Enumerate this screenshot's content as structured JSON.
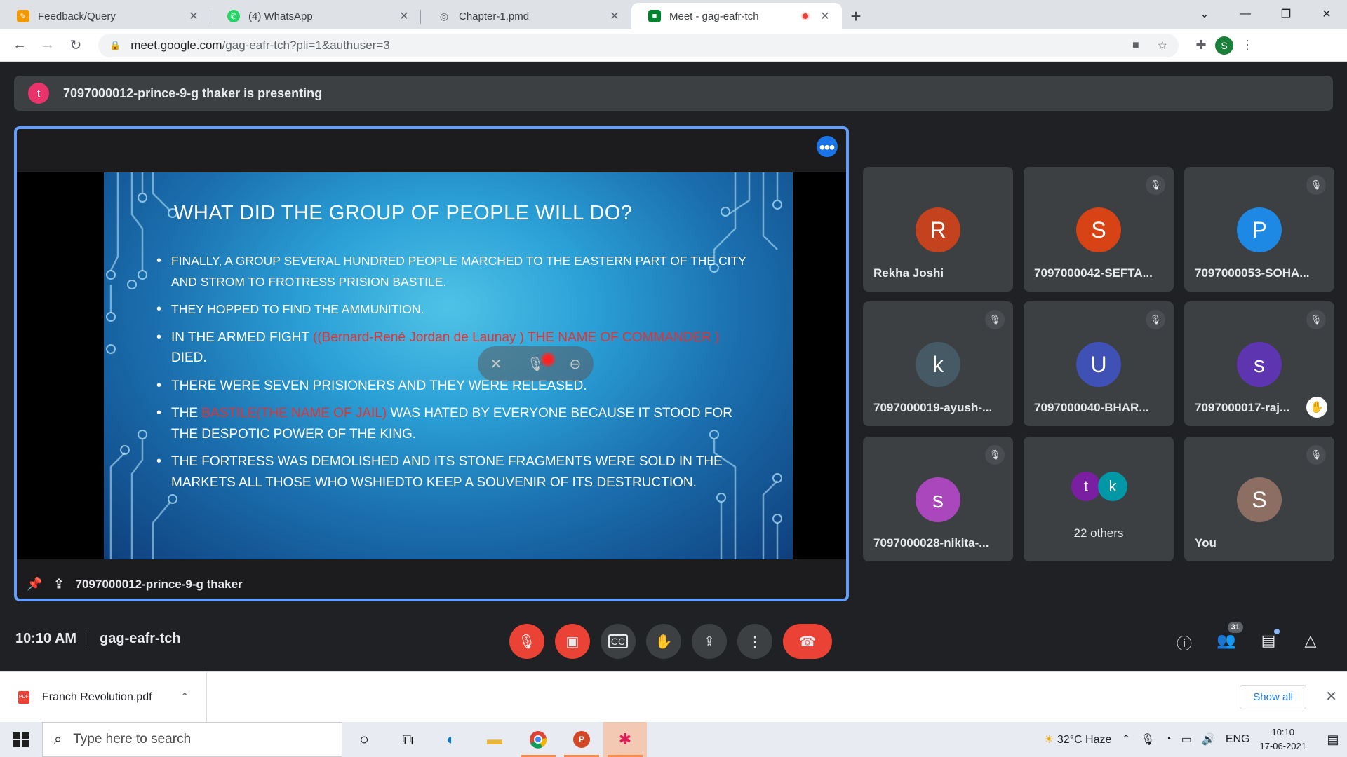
{
  "browser": {
    "tabs": [
      {
        "title": "Feedback/Query",
        "icon": "feedback-icon",
        "color": "#f29900"
      },
      {
        "title": "(4) WhatsApp",
        "icon": "whatsapp-icon",
        "color": "#25d366"
      },
      {
        "title": "Chapter-1.pmd",
        "icon": "globe-icon",
        "color": "#9aa0a6"
      },
      {
        "title": "Meet - gag-eafr-tch",
        "icon": "meet-icon",
        "color": "#00832d"
      }
    ],
    "address": {
      "domain": "meet.google.com",
      "path": "/gag-eafr-tch?pli=1&authuser=3"
    },
    "profile_initial": "S"
  },
  "meet": {
    "banner": {
      "avatar": "t",
      "text": "7097000012-prince-9-g thaker is presenting"
    },
    "presenter_name": "7097000012-prince-9-g thaker",
    "slide": {
      "title": "WHAT DID THE GROUP OF PEOPLE WILL DO?",
      "bullets": [
        {
          "parts": [
            {
              "t": "FINALLY, A GROUP SEVERAL HUNDRED PEOPLE MARCHED TO THE EASTERN PART  OF THE CITY  AND STROM TO FROTRESS PRISION  BASTILE.",
              "red": false
            }
          ],
          "small": true
        },
        {
          "parts": [
            {
              "t": "THEY HOPPED  TO  FIND THE AMMUNITION.",
              "red": false
            }
          ],
          "small": true
        },
        {
          "parts": [
            {
              "t": "IN THE ARMED FIGHT ",
              "red": false
            },
            {
              "t": "((Bernard-René Jordan de Launay ) THE NAME OF COMMANDER )",
              "red": true
            },
            {
              "t": " DIED.",
              "red": false
            }
          ],
          "small": false
        },
        {
          "parts": [
            {
              "t": "THERE WERE SEVEN PRISIONERS AND THEY WERE RELEASED.",
              "red": false
            }
          ],
          "small": false
        },
        {
          "parts": [
            {
              "t": "THE ",
              "red": false
            },
            {
              "t": "BASTILE(THE NAME OF JAIL)",
              "red": true
            },
            {
              "t": " WAS HATED BY EVERYONE  BECAUSE IT STOOD FOR THE DESPOTIC POWER OF THE KING.",
              "red": false
            }
          ],
          "small": false
        },
        {
          "parts": [
            {
              "t": "THE FORTRESS WAS DEMOLISHED AND ITS STONE FRAGMENTS WERE SOLD IN THE MARKETS ALL THOSE WHO WSHIEDTO KEEP A SOUVENIR OF ITS DESTRUCTION.",
              "red": false
            }
          ],
          "small": false
        }
      ]
    },
    "tiles": [
      {
        "initial": "R",
        "name": "Rekha Joshi",
        "color": "#c5421e",
        "muted": false,
        "hand": false
      },
      {
        "initial": "S",
        "name": "7097000042-SEFTA...",
        "color": "#d84315",
        "muted": true,
        "hand": false
      },
      {
        "initial": "P",
        "name": "7097000053-SOHA...",
        "color": "#1e88e5",
        "muted": true,
        "hand": false
      },
      {
        "initial": "k",
        "name": "7097000019-ayush-...",
        "color": "#455a64",
        "muted": true,
        "hand": false
      },
      {
        "initial": "U",
        "name": "7097000040-BHAR...",
        "color": "#3f51b5",
        "muted": true,
        "hand": false
      },
      {
        "initial": "s",
        "name": "7097000017-raj...",
        "color": "#5e35b1",
        "muted": true,
        "hand": true
      },
      {
        "initial": "s",
        "name": "7097000028-nikita-...",
        "color": "#ab47bc",
        "muted": true,
        "hand": false
      },
      {
        "initial": "",
        "name": "",
        "color": "",
        "muted": false,
        "hand": false
      },
      {
        "initial": "S",
        "name": "You",
        "color": "#8d6e63",
        "muted": true,
        "hand": false
      }
    ],
    "others": {
      "label": "22 others",
      "a": "t",
      "a_color": "#7b1fa2",
      "b": "k",
      "b_color": "#0097a7"
    },
    "time": "10:10 AM",
    "meeting_code": "gag-eafr-tch",
    "people_count": "31"
  },
  "download": {
    "file": "Franch Revolution.pdf",
    "show_all": "Show all"
  },
  "taskbar": {
    "search_placeholder": "Type here to search",
    "weather": "32°C  Haze",
    "lang": "ENG",
    "time": "10:10",
    "date": "17-06-2021"
  }
}
